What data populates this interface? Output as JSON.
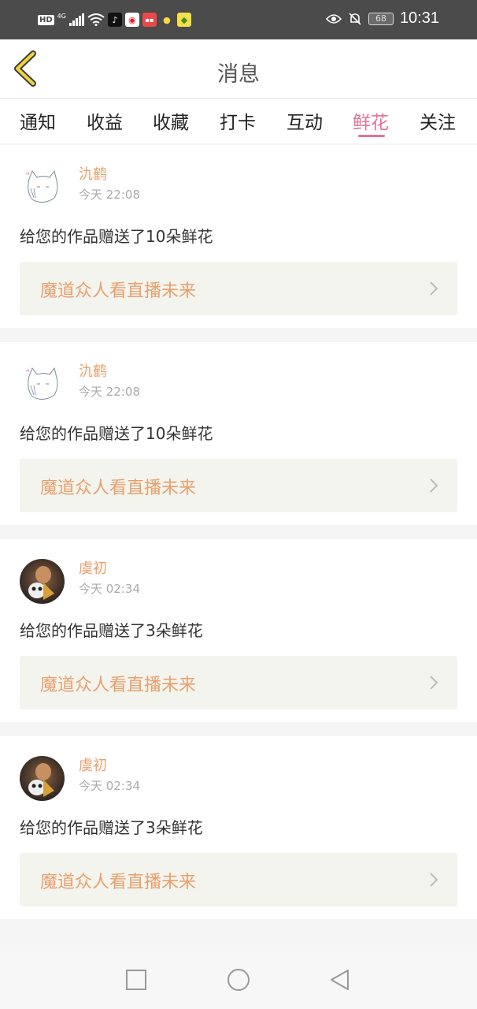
{
  "status_bar": {
    "hd": "HD",
    "network": "4G",
    "battery": "68",
    "time": "10:31",
    "icons": [
      "signal-icon",
      "wifi-icon",
      "tiktok-icon",
      "weibo-icon",
      "app-icon",
      "bulb-icon",
      "game-icon",
      "eye-icon",
      "bell-off-icon",
      "battery-icon"
    ]
  },
  "header": {
    "title": "消息",
    "back_icon": "chevron-left-icon"
  },
  "tabs": [
    {
      "label": "通知"
    },
    {
      "label": "收益"
    },
    {
      "label": "收藏"
    },
    {
      "label": "打卡"
    },
    {
      "label": "互动"
    },
    {
      "label": "鲜花",
      "active": true
    },
    {
      "label": "关注"
    }
  ],
  "messages": [
    {
      "user": "氿鹤",
      "time": "今天 22:08",
      "text": "给您的作品赠送了10朵鲜花",
      "work": "魔道众人看直播未来",
      "avatar": "sketch-cat"
    },
    {
      "user": "氿鹤",
      "time": "今天 22:08",
      "text": "给您的作品赠送了10朵鲜花",
      "work": "魔道众人看直播未来",
      "avatar": "sketch-cat"
    },
    {
      "user": "虞初",
      "time": "今天 02:34",
      "text": "给您的作品赠送了3朵鲜花",
      "work": "魔道众人看直播未来",
      "avatar": "photo"
    },
    {
      "user": "虞初",
      "time": "今天 02:34",
      "text": "给您的作品赠送了3朵鲜花",
      "work": "魔道众人看直播未来",
      "avatar": "photo"
    }
  ],
  "nav": {
    "recents_icon": "square-icon",
    "home_icon": "circle-icon",
    "back_icon": "triangle-back-icon"
  },
  "colors": {
    "accent_pink": "#e5719a",
    "username_orange": "#e8a06c",
    "header_yellow": "#f0d23c"
  }
}
